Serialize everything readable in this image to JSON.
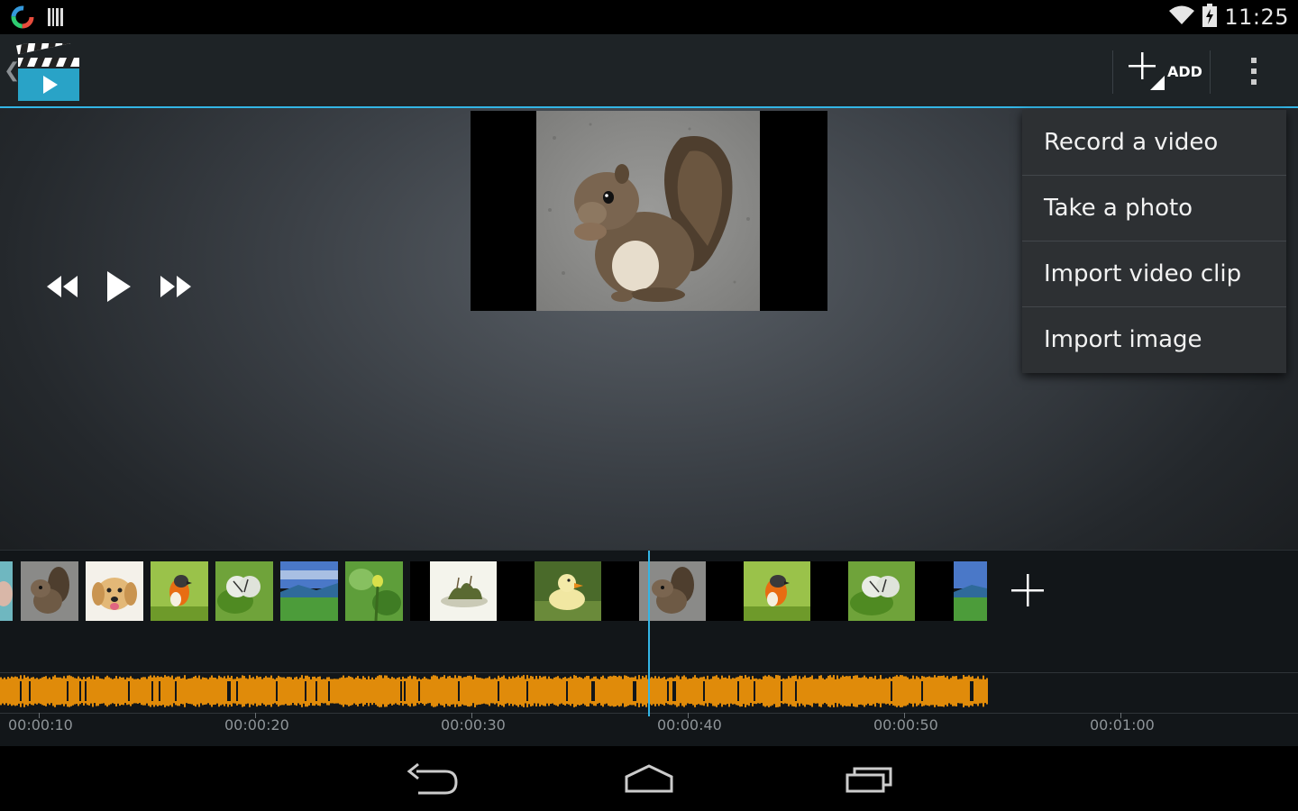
{
  "status_bar": {
    "time": "11:25",
    "icons": [
      "app-notification-icon",
      "barcode-notification-icon",
      "wifi-icon",
      "battery-charging-icon"
    ]
  },
  "action_bar": {
    "up_icon": "chevron-left-icon",
    "app_icon": "clapperboard-play-icon",
    "add_label": "ADD",
    "overflow_icon": "overflow-menu-icon"
  },
  "preview": {
    "subject": "squirrel photo"
  },
  "transport": {
    "rewind_icon": "rewind-icon",
    "play_icon": "play-icon",
    "fast_forward_icon": "fast-forward-icon"
  },
  "add_menu": {
    "items": [
      {
        "label": "Record a video"
      },
      {
        "label": "Take a photo"
      },
      {
        "label": "Import video clip"
      },
      {
        "label": "Import image"
      }
    ]
  },
  "timeline": {
    "clips": [
      "fox",
      "squirrel",
      "puppy",
      "robin",
      "butterfly",
      "lake",
      "plant",
      "island",
      "duckling",
      "squirrel",
      "robin",
      "butterfly",
      "lake"
    ],
    "ruler_labels": [
      "00:00:10",
      "00:00:20",
      "00:00:30",
      "00:00:40",
      "00:00:50",
      "00:01:00"
    ],
    "audio_color": "#e08b0a",
    "accent_color": "#33b5e5"
  },
  "nav_bar": {
    "back_icon": "back-icon",
    "home_icon": "home-icon",
    "recents_icon": "recents-icon"
  }
}
